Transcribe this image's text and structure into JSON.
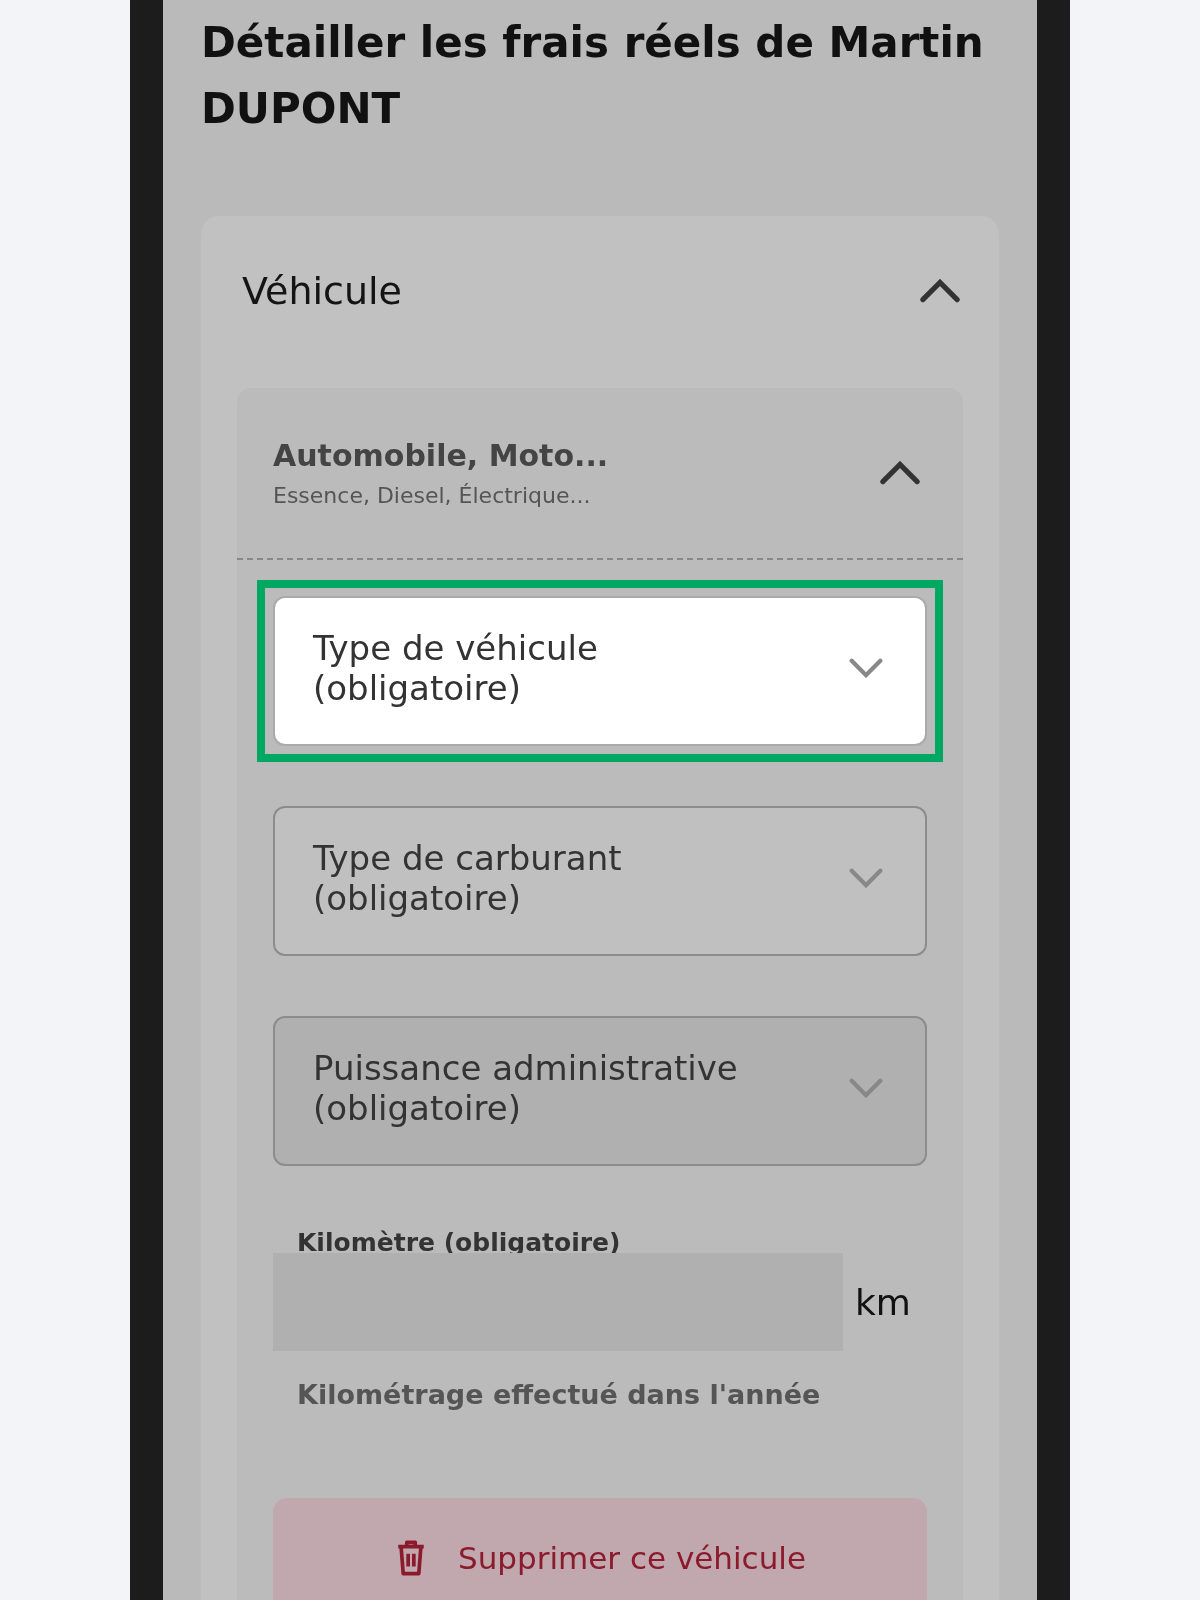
{
  "title": "Détailler les frais réels de Martin DUPONT",
  "section": {
    "title": "Véhicule",
    "expanded": true,
    "vehicle": {
      "title": "Automobile, Moto...",
      "subtitle": "Essence, Diesel, Électrique...",
      "expanded": true,
      "fields": [
        {
          "kind": "select",
          "placeholder": "Type de véhicule (obligatoire)",
          "highlighted": true,
          "disabled": false
        },
        {
          "kind": "select",
          "placeholder": "Type de carburant (obligatoire)",
          "highlighted": false,
          "disabled": false
        },
        {
          "kind": "select",
          "placeholder": "Puissance administrative (obligatoire)",
          "highlighted": false,
          "disabled": true
        },
        {
          "kind": "number",
          "label": "Kilomètre (obligatoire)",
          "unit": "km",
          "hint": "Kilométrage effectué dans l'année",
          "highlighted": false,
          "disabled": false
        }
      ],
      "delete_button": "Supprimer ce véhicule"
    }
  }
}
